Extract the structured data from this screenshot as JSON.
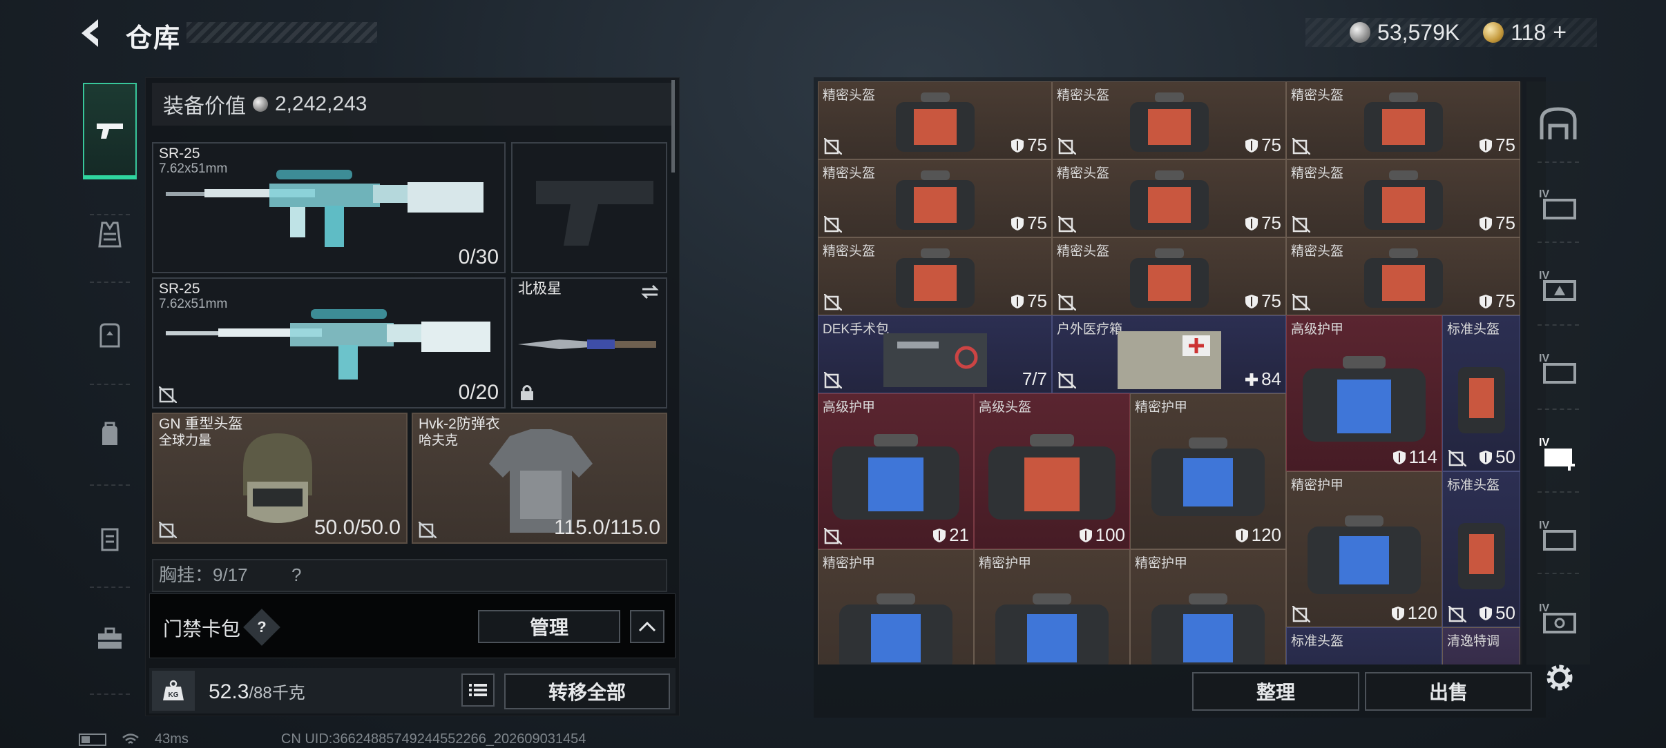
{
  "header": {
    "title": "仓库",
    "currency_silver": "53,579K",
    "currency_gold": "118",
    "currency_gold_plus": "+"
  },
  "equipment": {
    "value_label": "装备价值",
    "value": "2,242,243",
    "primary_weapon": {
      "name": "SR-25",
      "ammo_type": "7.62x51mm",
      "ammo": "0/30"
    },
    "secondary_weapon": {
      "name": "SR-25",
      "ammo_type": "7.62x51mm",
      "ammo": "0/20"
    },
    "melee": {
      "name": "北极星"
    },
    "helmet": {
      "name": "GN 重型头盔",
      "sub": "全球力量",
      "durability": "50.0/50.0"
    },
    "armor": {
      "name": "Hvk-2防弹衣",
      "sub": "哈夫克",
      "durability": "115.0/115.0"
    },
    "chest_rig": "胸挂：9/17",
    "chest_rig_help": "?",
    "keycard": {
      "label": "门禁卡包",
      "help": "?",
      "manage_button": "管理"
    },
    "weight": {
      "current": "52.3",
      "max": "/88千克",
      "icon_text": "KG"
    },
    "transfer_all_button": "转移全部"
  },
  "status": {
    "ping": "43ms",
    "uid": "CN UID:36624885749244552266_202609031454"
  },
  "stash": {
    "items": [
      {
        "label": "精密头盔",
        "value": "75",
        "color": "brown"
      },
      {
        "label": "精密头盔",
        "value": "75",
        "color": "brown"
      },
      {
        "label": "精密头盔",
        "value": "75",
        "color": "brown"
      },
      {
        "label": "精密头盔",
        "value": "75",
        "color": "brown"
      },
      {
        "label": "精密头盔",
        "value": "75",
        "color": "brown"
      },
      {
        "label": "精密头盔",
        "value": "75",
        "color": "brown"
      },
      {
        "label": "精密头盔",
        "value": "75",
        "color": "brown"
      },
      {
        "label": "精密头盔",
        "value": "75",
        "color": "brown"
      },
      {
        "label": "精密头盔",
        "value": "75",
        "color": "brown"
      },
      {
        "label": "DEK手术包",
        "value": "7/7",
        "color": "blue"
      },
      {
        "label": "户外医疗箱",
        "value": "84",
        "color": "blue"
      },
      {
        "label": "高级护甲",
        "value": "114",
        "color": "red"
      },
      {
        "label": "标准头盔",
        "value": "50",
        "color": "blue"
      },
      {
        "label": "高级护甲",
        "value": "21",
        "color": "red"
      },
      {
        "label": "高级头盔",
        "value": "100",
        "color": "red"
      },
      {
        "label": "精密护甲",
        "value": "120",
        "color": "brown"
      },
      {
        "label": "精密护甲",
        "value": "120",
        "color": "brown"
      },
      {
        "label": "标准头盔",
        "value": "50",
        "color": "blue"
      },
      {
        "label": "精密护甲",
        "value": "",
        "color": "brown"
      },
      {
        "label": "精密护甲",
        "value": "",
        "color": "brown"
      },
      {
        "label": "精密护甲",
        "value": "",
        "color": "brown"
      },
      {
        "label": "标准头盔",
        "value": "",
        "color": "blue"
      },
      {
        "label": "清逸特调",
        "value": "",
        "color": "purple"
      }
    ],
    "sort_button": "整理",
    "sell_button": "出售"
  },
  "side_pages": [
    "IV",
    "IV",
    "IV",
    "IV",
    "IV",
    "IV"
  ],
  "colors": {
    "accent": "#2fd69f",
    "brown": "#4a3c33",
    "red": "#5a2530",
    "blue": "#2c2f52"
  }
}
